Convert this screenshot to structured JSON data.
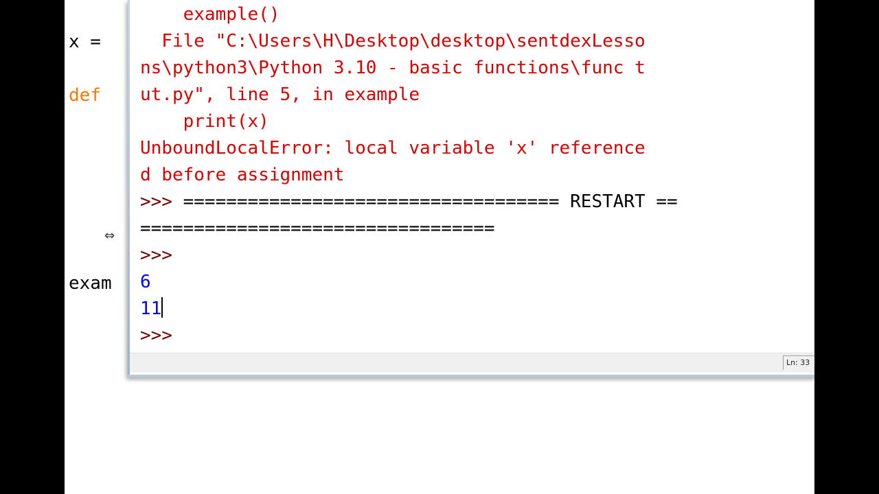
{
  "editor": {
    "lines": [
      {
        "text": "x = ",
        "kind": "plain"
      },
      {
        "text": "def",
        "kind": "keyword"
      },
      {
        "text": "exam",
        "kind": "plain"
      }
    ],
    "resize_cursor_icon": "resize-horizontal-icon"
  },
  "shell": {
    "lines": [
      "    example()",
      "  File \"C:\\Users\\H\\Desktop\\desktop\\sentdexLesso",
      "ns\\python3\\Python 3.10 - basic functions\\func t",
      "ut.py\", line 5, in example",
      "    print(x)",
      "UnboundLocalError: local variable 'x' reference",
      "d before assignment",
      ">>> ",
      "=================================== RESTART ==",
      "=================================",
      ">>> ",
      "6",
      "11",
      ">>> "
    ],
    "restart_separator_a": "=================================== RESTART ==",
    "output_1": "6",
    "output_2": "11"
  },
  "statusbar": {
    "ln_label": "Ln: 33"
  },
  "colors": {
    "error": "#dd0000",
    "prompt": "#770000",
    "output": "#0000ff",
    "keyword": "#ff7700"
  }
}
